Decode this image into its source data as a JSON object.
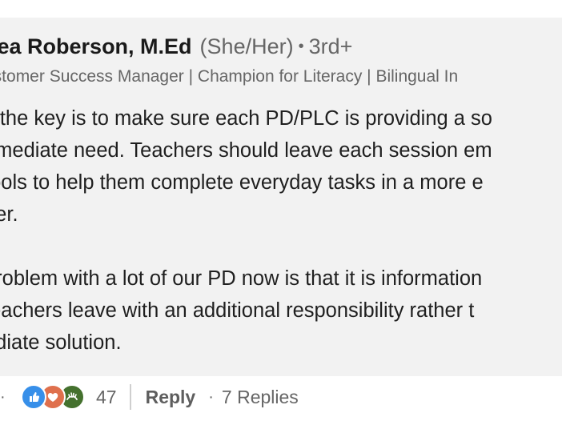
{
  "comment": {
    "author": {
      "name": "rea Roberson, M.Ed",
      "pronouns": "(She/Her)",
      "separator": "•",
      "degree": "3rd+",
      "headline": "ustomer Success Manager | Champion for Literacy | Bilingual In"
    },
    "body": {
      "paragraph1": [
        "k the key is to make sure each PD/PLC is providing a so",
        "nmediate need. Teachers should leave each session em",
        "tools to help them complete everyday tasks in a more e",
        "her."
      ],
      "paragraph2": [
        "problem with a lot of our PD now is that it is information",
        "teachers leave with an additional responsibility rather t",
        "ediate solution."
      ]
    },
    "footer": {
      "lead_separator": "·",
      "reactions": {
        "icons": [
          "like-icon",
          "love-icon",
          "support-icon"
        ],
        "colors": {
          "like": "#378fe9",
          "love": "#df704d",
          "support": "#44712e"
        },
        "count": "47"
      },
      "reply_label": "Reply",
      "separator": "·",
      "replies_label": "7 Replies"
    }
  }
}
